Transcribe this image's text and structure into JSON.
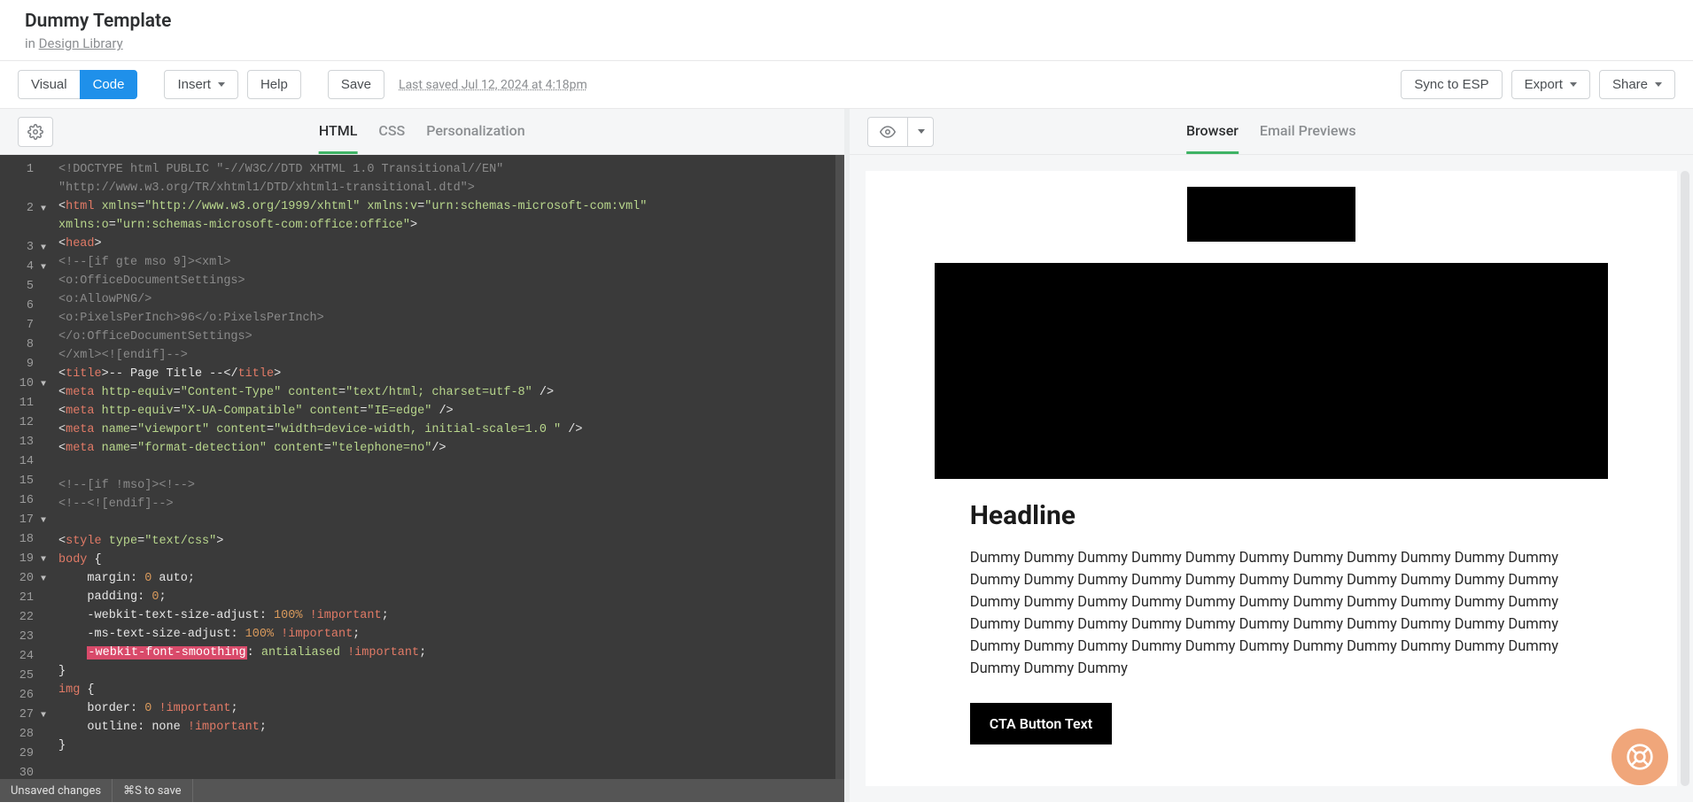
{
  "header": {
    "title": "Dummy Template",
    "in_prefix": "in ",
    "library_link": "Design Library"
  },
  "toolbar": {
    "visual_label": "Visual",
    "code_label": "Code",
    "insert_label": "Insert",
    "help_label": "Help",
    "save_label": "Save",
    "save_status": "Last saved Jul 12, 2024 at 4:18pm",
    "sync_label": "Sync to ESP",
    "export_label": "Export",
    "share_label": "Share"
  },
  "editor": {
    "tabs": {
      "html": "HTML",
      "css": "CSS",
      "personalization": "Personalization"
    },
    "status_unsaved": "Unsaved changes",
    "status_save_hint": "⌘S to save",
    "gutter": [
      {
        "n": "1",
        "fold": ""
      },
      {
        "n": "",
        "fold": ""
      },
      {
        "n": "2",
        "fold": "▼"
      },
      {
        "n": "",
        "fold": ""
      },
      {
        "n": "3",
        "fold": "▼"
      },
      {
        "n": "4",
        "fold": "▼"
      },
      {
        "n": "5",
        "fold": ""
      },
      {
        "n": "6",
        "fold": ""
      },
      {
        "n": "7",
        "fold": ""
      },
      {
        "n": "8",
        "fold": ""
      },
      {
        "n": "9",
        "fold": ""
      },
      {
        "n": "10",
        "fold": "▼"
      },
      {
        "n": "11",
        "fold": ""
      },
      {
        "n": "12",
        "fold": ""
      },
      {
        "n": "13",
        "fold": ""
      },
      {
        "n": "14",
        "fold": ""
      },
      {
        "n": "15",
        "fold": ""
      },
      {
        "n": "16",
        "fold": ""
      },
      {
        "n": "17",
        "fold": "▼"
      },
      {
        "n": "18",
        "fold": ""
      },
      {
        "n": "19",
        "fold": "▼"
      },
      {
        "n": "20",
        "fold": "▼"
      },
      {
        "n": "21",
        "fold": ""
      },
      {
        "n": "22",
        "fold": ""
      },
      {
        "n": "23",
        "fold": ""
      },
      {
        "n": "24",
        "fold": ""
      },
      {
        "n": "25",
        "fold": ""
      },
      {
        "n": "26",
        "fold": ""
      },
      {
        "n": "27",
        "fold": "▼"
      },
      {
        "n": "28",
        "fold": ""
      },
      {
        "n": "29",
        "fold": ""
      },
      {
        "n": "30",
        "fold": ""
      }
    ],
    "code_lines": [
      [
        {
          "c": "c-comment",
          "t": "<!DOCTYPE html PUBLIC \"-//W3C//DTD XHTML 1.0 Transitional//EN\" "
        }
      ],
      [
        {
          "c": "c-comment",
          "t": "\"http://www.w3.org/TR/xhtml1/DTD/xhtml1-transitional.dtd\">"
        }
      ],
      [
        {
          "c": "c-punct",
          "t": "<"
        },
        {
          "c": "c-tag",
          "t": "html"
        },
        {
          "c": "c-text",
          "t": " "
        },
        {
          "c": "c-attr",
          "t": "xmlns"
        },
        {
          "c": "c-punct",
          "t": "="
        },
        {
          "c": "c-str",
          "t": "\"http://www.w3.org/1999/xhtml\""
        },
        {
          "c": "c-text",
          "t": " "
        },
        {
          "c": "c-attr",
          "t": "xmlns:v"
        },
        {
          "c": "c-punct",
          "t": "="
        },
        {
          "c": "c-str",
          "t": "\"urn:schemas-microsoft-com:vml\""
        }
      ],
      [
        {
          "c": "c-attr",
          "t": "xmlns:o"
        },
        {
          "c": "c-punct",
          "t": "="
        },
        {
          "c": "c-str",
          "t": "\"urn:schemas-microsoft-com:office:office\""
        },
        {
          "c": "c-punct",
          "t": ">"
        }
      ],
      [
        {
          "c": "c-punct",
          "t": "<"
        },
        {
          "c": "c-tag",
          "t": "head"
        },
        {
          "c": "c-punct",
          "t": ">"
        }
      ],
      [
        {
          "c": "c-comment",
          "t": "<!--[if gte mso 9]><xml>"
        }
      ],
      [
        {
          "c": "c-comment",
          "t": "<o:OfficeDocumentSettings>"
        }
      ],
      [
        {
          "c": "c-comment",
          "t": "<o:AllowPNG/>"
        }
      ],
      [
        {
          "c": "c-comment",
          "t": "<o:PixelsPerInch>96</o:PixelsPerInch>"
        }
      ],
      [
        {
          "c": "c-comment",
          "t": "</o:OfficeDocumentSettings>"
        }
      ],
      [
        {
          "c": "c-comment",
          "t": "</xml><![endif]-->"
        }
      ],
      [
        {
          "c": "c-punct",
          "t": "<"
        },
        {
          "c": "c-tag",
          "t": "title"
        },
        {
          "c": "c-punct",
          "t": ">"
        },
        {
          "c": "c-text",
          "t": "-- Page Title --"
        },
        {
          "c": "c-punct",
          "t": "</"
        },
        {
          "c": "c-tag",
          "t": "title"
        },
        {
          "c": "c-punct",
          "t": ">"
        }
      ],
      [
        {
          "c": "c-punct",
          "t": "<"
        },
        {
          "c": "c-tag",
          "t": "meta"
        },
        {
          "c": "c-text",
          "t": " "
        },
        {
          "c": "c-attr",
          "t": "http-equiv"
        },
        {
          "c": "c-punct",
          "t": "="
        },
        {
          "c": "c-str",
          "t": "\"Content-Type\""
        },
        {
          "c": "c-text",
          "t": " "
        },
        {
          "c": "c-attr",
          "t": "content"
        },
        {
          "c": "c-punct",
          "t": "="
        },
        {
          "c": "c-str",
          "t": "\"text/html; charset=utf-8\""
        },
        {
          "c": "c-text",
          "t": " "
        },
        {
          "c": "c-punct",
          "t": "/>"
        }
      ],
      [
        {
          "c": "c-punct",
          "t": "<"
        },
        {
          "c": "c-tag",
          "t": "meta"
        },
        {
          "c": "c-text",
          "t": " "
        },
        {
          "c": "c-attr",
          "t": "http-equiv"
        },
        {
          "c": "c-punct",
          "t": "="
        },
        {
          "c": "c-str",
          "t": "\"X-UA-Compatible\""
        },
        {
          "c": "c-text",
          "t": " "
        },
        {
          "c": "c-attr",
          "t": "content"
        },
        {
          "c": "c-punct",
          "t": "="
        },
        {
          "c": "c-str",
          "t": "\"IE=edge\""
        },
        {
          "c": "c-text",
          "t": " "
        },
        {
          "c": "c-punct",
          "t": "/>"
        }
      ],
      [
        {
          "c": "c-punct",
          "t": "<"
        },
        {
          "c": "c-tag",
          "t": "meta"
        },
        {
          "c": "c-text",
          "t": " "
        },
        {
          "c": "c-attr",
          "t": "name"
        },
        {
          "c": "c-punct",
          "t": "="
        },
        {
          "c": "c-str",
          "t": "\"viewport\""
        },
        {
          "c": "c-text",
          "t": " "
        },
        {
          "c": "c-attr",
          "t": "content"
        },
        {
          "c": "c-punct",
          "t": "="
        },
        {
          "c": "c-str",
          "t": "\"width=device-width, initial-scale=1.0 \""
        },
        {
          "c": "c-text",
          "t": " "
        },
        {
          "c": "c-punct",
          "t": "/>"
        }
      ],
      [
        {
          "c": "c-punct",
          "t": "<"
        },
        {
          "c": "c-tag",
          "t": "meta"
        },
        {
          "c": "c-text",
          "t": " "
        },
        {
          "c": "c-attr",
          "t": "name"
        },
        {
          "c": "c-punct",
          "t": "="
        },
        {
          "c": "c-str",
          "t": "\"format-detection\""
        },
        {
          "c": "c-text",
          "t": " "
        },
        {
          "c": "c-attr",
          "t": "content"
        },
        {
          "c": "c-punct",
          "t": "="
        },
        {
          "c": "c-str",
          "t": "\"telephone=no\""
        },
        {
          "c": "c-punct",
          "t": "/>"
        }
      ],
      [
        {
          "c": "c-text",
          "t": " "
        }
      ],
      [
        {
          "c": "c-comment",
          "t": "<!--[if !mso]><!-->"
        }
      ],
      [
        {
          "c": "c-comment",
          "t": "<!--<![endif]-->"
        }
      ],
      [
        {
          "c": "c-text",
          "t": " "
        }
      ],
      [
        {
          "c": "c-punct",
          "t": "<"
        },
        {
          "c": "c-tag",
          "t": "style"
        },
        {
          "c": "c-text",
          "t": " "
        },
        {
          "c": "c-attr",
          "t": "type"
        },
        {
          "c": "c-punct",
          "t": "="
        },
        {
          "c": "c-str",
          "t": "\"text/css\""
        },
        {
          "c": "c-punct",
          "t": ">"
        }
      ],
      [
        {
          "c": "c-sel",
          "t": "body"
        },
        {
          "c": "c-text",
          "t": " "
        },
        {
          "c": "c-punct",
          "t": "{"
        }
      ],
      [
        {
          "c": "c-text",
          "t": "    "
        },
        {
          "c": "c-prop",
          "t": "margin"
        },
        {
          "c": "c-punct",
          "t": ": "
        },
        {
          "c": "c-num",
          "t": "0"
        },
        {
          "c": "c-text",
          "t": " auto"
        },
        {
          "c": "c-punct",
          "t": ";"
        }
      ],
      [
        {
          "c": "c-text",
          "t": "    "
        },
        {
          "c": "c-prop",
          "t": "padding"
        },
        {
          "c": "c-punct",
          "t": ": "
        },
        {
          "c": "c-num",
          "t": "0"
        },
        {
          "c": "c-punct",
          "t": ";"
        }
      ],
      [
        {
          "c": "c-text",
          "t": "    "
        },
        {
          "c": "c-prop",
          "t": "-webkit-text-size-adjust"
        },
        {
          "c": "c-punct",
          "t": ": "
        },
        {
          "c": "c-num",
          "t": "100%"
        },
        {
          "c": "c-text",
          "t": " "
        },
        {
          "c": "c-important",
          "t": "!important"
        },
        {
          "c": "c-punct",
          "t": ";"
        }
      ],
      [
        {
          "c": "c-text",
          "t": "    "
        },
        {
          "c": "c-prop",
          "t": "-ms-text-size-adjust"
        },
        {
          "c": "c-punct",
          "t": ": "
        },
        {
          "c": "c-num",
          "t": "100%"
        },
        {
          "c": "c-text",
          "t": " "
        },
        {
          "c": "c-important",
          "t": "!important"
        },
        {
          "c": "c-punct",
          "t": ";"
        }
      ],
      [
        {
          "c": "c-text",
          "t": "    "
        },
        {
          "c": "hl-err",
          "t": "-webkit-font-smoothing"
        },
        {
          "c": "c-punct",
          "t": ": "
        },
        {
          "c": "c-str",
          "t": "antialiased"
        },
        {
          "c": "c-text",
          "t": " "
        },
        {
          "c": "c-important",
          "t": "!important"
        },
        {
          "c": "c-punct",
          "t": ";"
        }
      ],
      [
        {
          "c": "c-punct",
          "t": "}"
        }
      ],
      [
        {
          "c": "c-sel",
          "t": "img"
        },
        {
          "c": "c-text",
          "t": " "
        },
        {
          "c": "c-punct",
          "t": "{"
        }
      ],
      [
        {
          "c": "c-text",
          "t": "    "
        },
        {
          "c": "c-prop",
          "t": "border"
        },
        {
          "c": "c-punct",
          "t": ": "
        },
        {
          "c": "c-num",
          "t": "0"
        },
        {
          "c": "c-text",
          "t": " "
        },
        {
          "c": "c-important",
          "t": "!important"
        },
        {
          "c": "c-punct",
          "t": ";"
        }
      ],
      [
        {
          "c": "c-text",
          "t": "    "
        },
        {
          "c": "c-prop",
          "t": "outline"
        },
        {
          "c": "c-punct",
          "t": ": "
        },
        {
          "c": "c-text",
          "t": "none "
        },
        {
          "c": "c-important",
          "t": "!important"
        },
        {
          "c": "c-punct",
          "t": ";"
        }
      ],
      [
        {
          "c": "c-punct",
          "t": "}"
        }
      ]
    ]
  },
  "preview": {
    "tabs": {
      "browser": "Browser",
      "email": "Email Previews"
    },
    "headline": "Headline",
    "body_text": "Dummy Dummy Dummy Dummy Dummy Dummy Dummy Dummy Dummy Dummy Dummy Dummy Dummy Dummy Dummy Dummy Dummy Dummy Dummy Dummy Dummy Dummy Dummy Dummy Dummy Dummy Dummy Dummy Dummy Dummy Dummy Dummy Dummy Dummy Dummy Dummy Dummy Dummy Dummy Dummy Dummy Dummy Dummy Dummy Dummy Dummy Dummy Dummy Dummy Dummy Dummy Dummy Dummy Dummy Dummy Dummy Dummy Dummy",
    "cta_label": "CTA Button Text"
  }
}
